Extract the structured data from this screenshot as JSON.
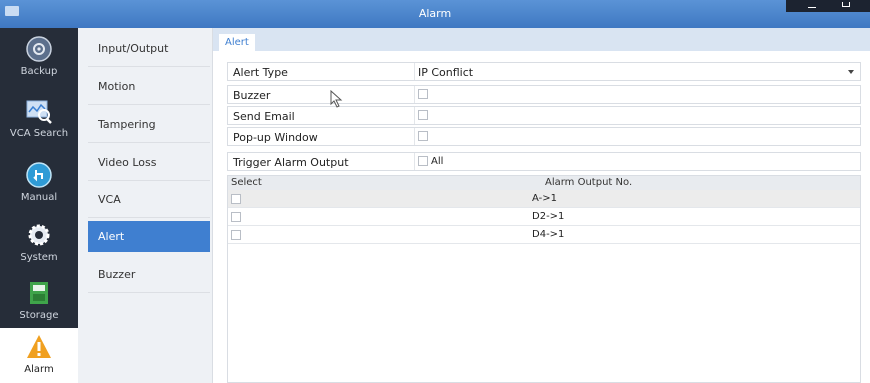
{
  "window": {
    "title": "Alarm"
  },
  "sidebar": {
    "items": [
      {
        "label": "Backup",
        "icon": "backup-icon"
      },
      {
        "label": "VCA Search",
        "icon": "vca-search-icon"
      },
      {
        "label": "Manual",
        "icon": "manual-icon"
      },
      {
        "label": "System",
        "icon": "system-icon"
      },
      {
        "label": "Storage",
        "icon": "storage-icon"
      },
      {
        "label": "Alarm",
        "icon": "alarm-icon",
        "active": true
      }
    ]
  },
  "menu": {
    "items": [
      {
        "label": "Input/Output"
      },
      {
        "label": "Motion"
      },
      {
        "label": "Tampering"
      },
      {
        "label": "Video Loss"
      },
      {
        "label": "VCA"
      },
      {
        "label": "Alert",
        "active": true
      },
      {
        "label": "Buzzer"
      }
    ]
  },
  "tabs": [
    {
      "label": "Alert"
    }
  ],
  "form": {
    "alert_type": {
      "label": "Alert Type",
      "value": "IP Conflict"
    },
    "buzzer": {
      "label": "Buzzer",
      "checked": false
    },
    "send_email": {
      "label": "Send Email",
      "checked": false
    },
    "popup_window": {
      "label": "Pop-up Window",
      "checked": false
    },
    "trigger_alarm_output": {
      "label": "Trigger Alarm Output",
      "all_label": "All",
      "checked": false
    }
  },
  "table": {
    "headers": {
      "select": "Select",
      "output": "Alarm Output No."
    },
    "rows": [
      {
        "output": "A->1",
        "checked": false
      },
      {
        "output": "D2->1",
        "checked": false
      },
      {
        "output": "D4->1",
        "checked": false
      }
    ]
  },
  "colors": {
    "titlebar": "#4a85cc",
    "sidebar": "#262d39",
    "accent": "#3f7fd0",
    "alarm_icon": "#f0a020"
  }
}
